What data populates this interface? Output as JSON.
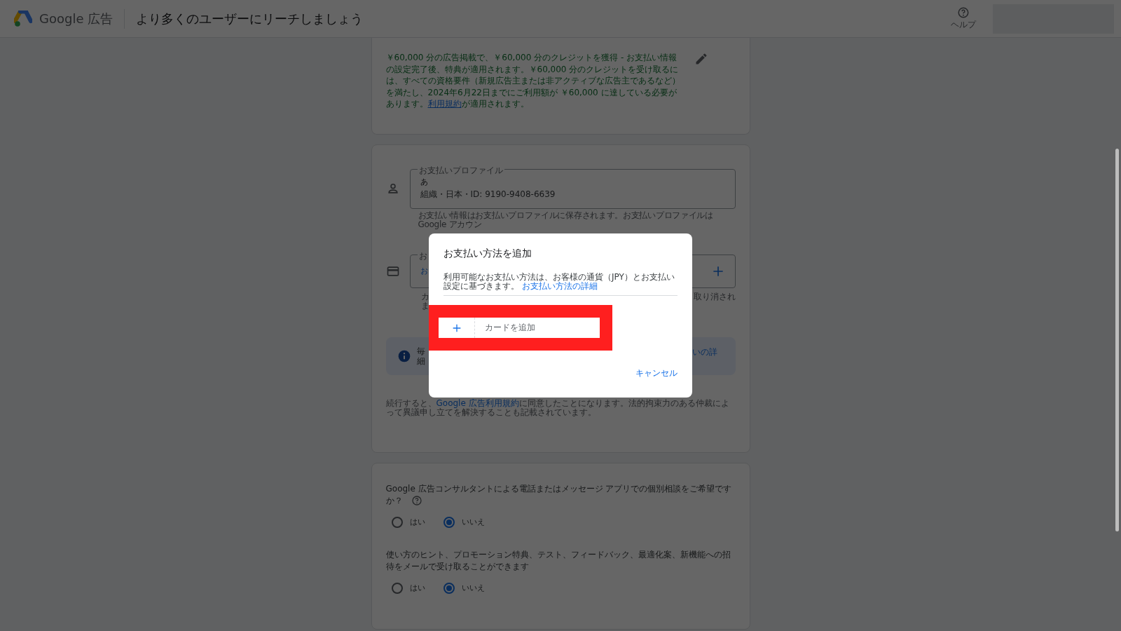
{
  "header": {
    "product": "Google 広告",
    "title": "より多くのユーザーにリーチしましょう",
    "help": "ヘルプ"
  },
  "promo": {
    "text_before": "￥60,000 分の広告掲載で、￥60,000 分のクレジットを獲得 - お支払い情報の設定完了後、特典が適用されます。￥60,000 分のクレジットを受け取るには、すべての資格要件（新規広告主または非アクティブな広告主であるなど）を満たし、2024年6月22日までにご利用額が ￥60,000 に達している必要があります。",
    "link": "利用規約",
    "text_after": "が適用されます。"
  },
  "payment_profile": {
    "legend": "お支払いプロファイル",
    "name": "あ",
    "details": "組織・日本・ID: 9190-9408-6639",
    "note": "お支払い情報はお支払いプロファイルに保存されます。お支払いプロファイルは Google アカウン"
  },
  "payment_method": {
    "legend": "お",
    "value": "お",
    "note_left": [
      "カ",
      "ま"
    ],
    "note_right": "取り消され"
  },
  "info": {
    "left": [
      "毎",
      "細"
    ],
    "right": "いの詳"
  },
  "terms": {
    "text_before": "続行すると、",
    "link": "Google 広告利用規約",
    "text_after": "に同意したことになります。法的拘束力のある仲裁によって異議申し立てを解決することも記載されています。"
  },
  "questions": [
    {
      "text": "Google 広告コンサルタントによる電話またはメッセージ アプリでの個別相談をご希望ですか？",
      "help": true,
      "options": [
        {
          "label": "はい",
          "selected": false
        },
        {
          "label": "いいえ",
          "selected": true
        }
      ]
    },
    {
      "text": "使い方のヒント、プロモーション特典、テスト、フィードバック、最適化案、新機能への招待をメールで受け取ることができます",
      "help": false,
      "options": [
        {
          "label": "はい",
          "selected": false
        },
        {
          "label": "いいえ",
          "selected": true
        }
      ]
    }
  ],
  "dialog": {
    "title": "お支払い方法を追加",
    "description": "利用可能なお支払い方法は、お客様の通貨（JPY）とお支払い設定に基づきます。",
    "link": "お支払い方法の詳細",
    "add_card": "カードを追加",
    "cancel": "キャンセル",
    "highlighted": true
  }
}
